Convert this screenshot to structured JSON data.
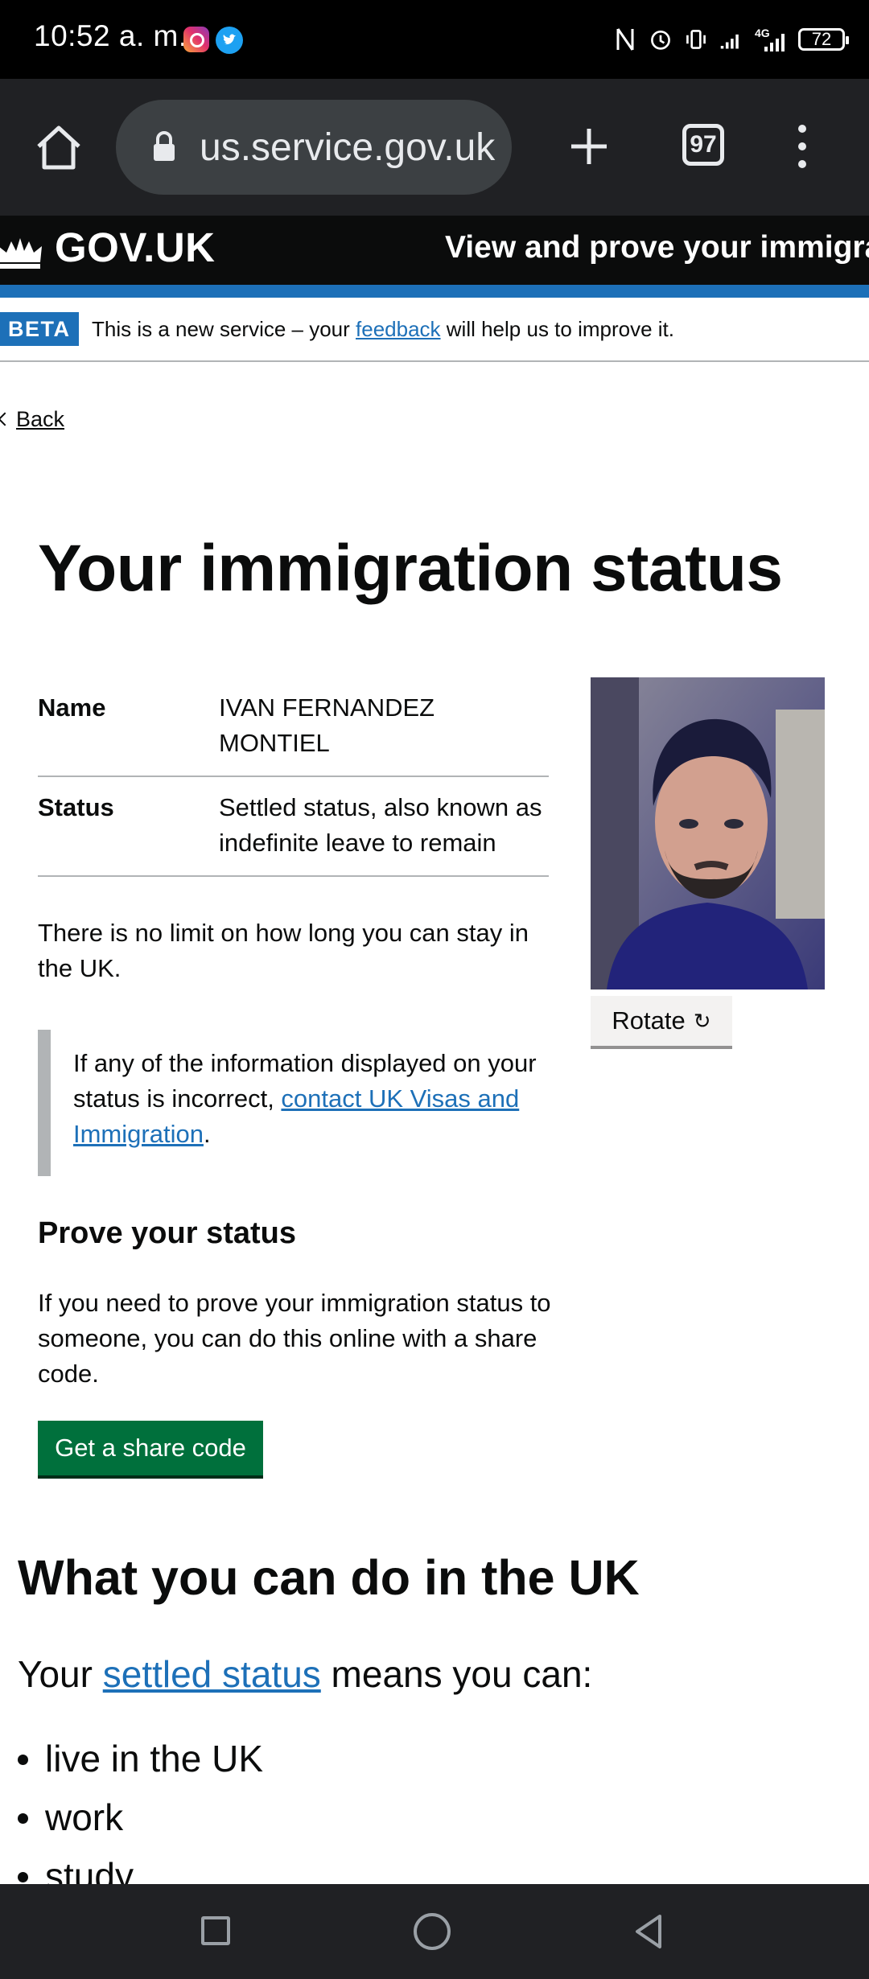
{
  "status_bar": {
    "time": "10:52 a. m.",
    "network": "4G",
    "battery": "72"
  },
  "browser": {
    "url": "us.service.gov.uk",
    "tab_count": "97"
  },
  "gov_header": {
    "logo_text": "GOV.UK",
    "service_name": "View and prove your immigra"
  },
  "beta_banner": {
    "tag": "BETA",
    "text_before": "This is a new service – your ",
    "link": "feedback",
    "text_after": " will help us to improve it."
  },
  "back_link": "Back",
  "page_title": "Your immigration status",
  "summary": {
    "rows": [
      {
        "key": "Name",
        "value": "IVAN FERNANDEZ MONTIEL"
      },
      {
        "key": "Status",
        "value": "Settled status, also known as indefinite leave to remain"
      }
    ]
  },
  "rotate_button": "Rotate",
  "rotate_glyph": "↻",
  "no_limit_text": "There is no limit on how long you can stay in the UK.",
  "inset": {
    "text_before": "If any of the information displayed on your status is incorrect, ",
    "link": "contact UK Visas and Immigration",
    "text_after": "."
  },
  "prove": {
    "heading": "Prove your status",
    "text": "If you need to prove your immigration status to someone, you can do this online with a share code.",
    "button": "Get a share code"
  },
  "what_you_can_do": {
    "heading": "What you can do in the UK",
    "intro_before": "Your ",
    "intro_link": "settled status",
    "intro_after": " means you can:",
    "items": [
      "live in the UK",
      "work",
      "study"
    ]
  },
  "colors": {
    "govuk_black": "#0b0c0c",
    "govuk_blue": "#1d70b8",
    "button_green": "#00703c",
    "border_grey": "#b1b4b6"
  }
}
